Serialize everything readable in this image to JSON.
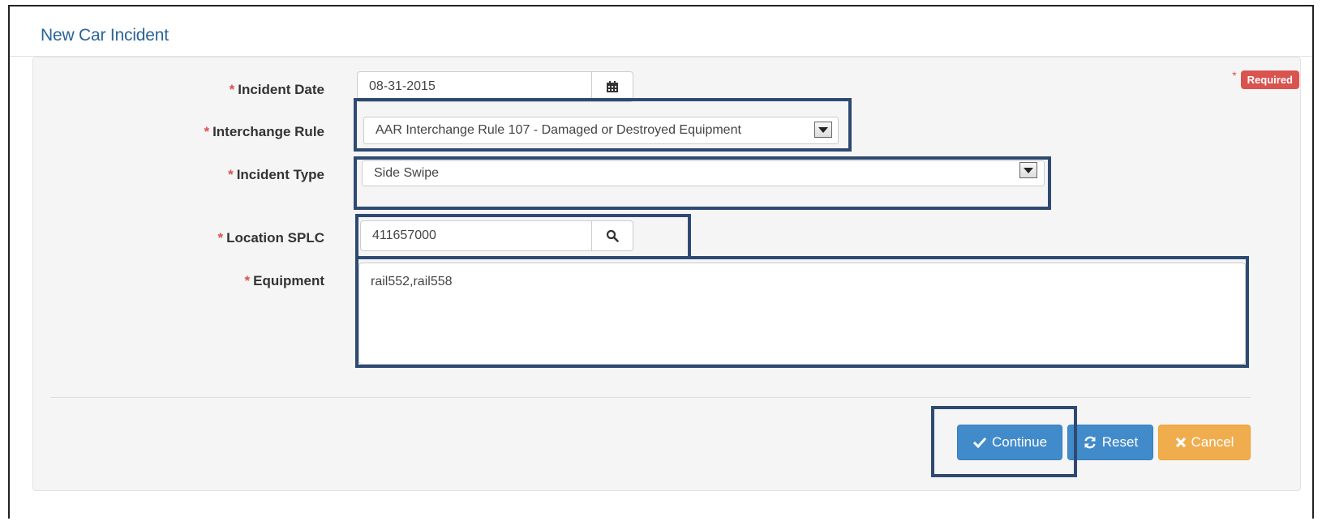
{
  "panel": {
    "title": "New Car Incident"
  },
  "required": {
    "star": "*",
    "badge": "Required"
  },
  "fields": {
    "incident_date": {
      "label": "Incident Date",
      "value": "08-31-2015"
    },
    "interchange_rule": {
      "label": "Interchange Rule",
      "value": "AAR Interchange Rule 107 - Damaged or Destroyed Equipment"
    },
    "incident_type": {
      "label": "Incident Type",
      "value": "Side Swipe"
    },
    "location_splc": {
      "label": "Location SPLC",
      "value": "411657000"
    },
    "equipment": {
      "label": "Equipment",
      "value": "rail552,rail558"
    }
  },
  "star": "*",
  "buttons": {
    "continue": "Continue",
    "reset": "Reset",
    "cancel": "Cancel"
  },
  "colors": {
    "primary": "#428bca",
    "warning": "#f0ad4e",
    "danger": "#d9534f",
    "highlight": "#2e4a72"
  }
}
